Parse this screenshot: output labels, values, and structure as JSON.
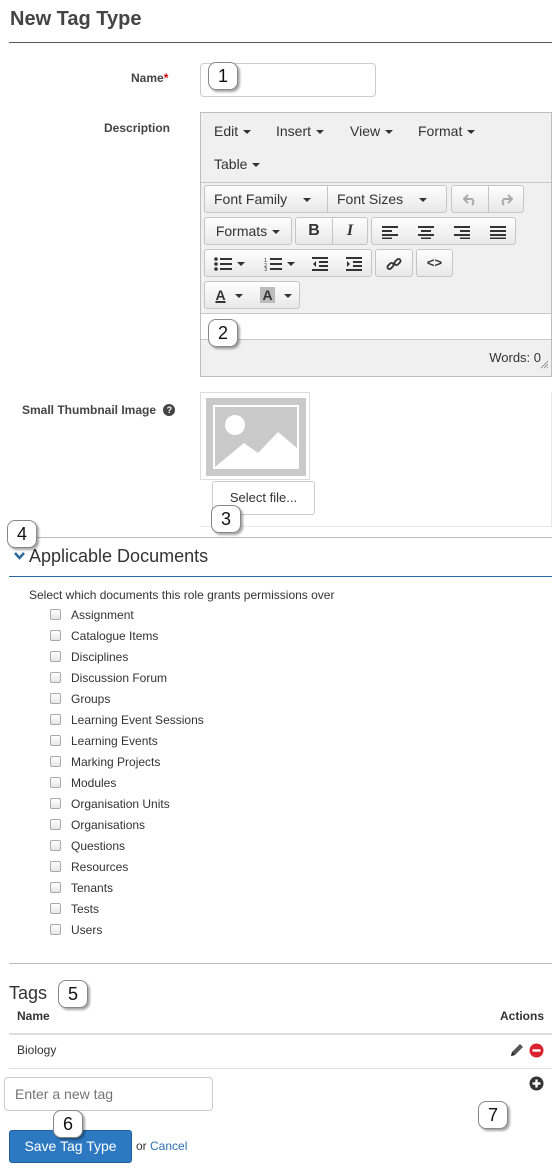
{
  "page": {
    "title": "New Tag Type"
  },
  "form": {
    "name_label": "Name",
    "required_mark": "*",
    "description_label": "Description",
    "thumbnail_label": "Small Thumbnail Image",
    "select_file_label": "Select file..."
  },
  "editor": {
    "menus": [
      "Edit",
      "Insert",
      "View",
      "Format",
      "Table"
    ],
    "font_family": "Font Family",
    "font_sizes": "Font Sizes",
    "formats": "Formats",
    "bold": "B",
    "italic": "I",
    "code": "<>",
    "text_color": "A",
    "bg_color": "A",
    "word_count": "Words: 0"
  },
  "documents": {
    "title": "Applicable Documents",
    "help": "Select which documents this role grants permissions over",
    "items": [
      "Assignment",
      "Catalogue Items",
      "Disciplines",
      "Discussion Forum",
      "Groups",
      "Learning Event Sessions",
      "Learning Events",
      "Marking Projects",
      "Modules",
      "Organisation Units",
      "Organisations",
      "Questions",
      "Resources",
      "Tenants",
      "Tests",
      "Users"
    ]
  },
  "tags": {
    "title": "Tags",
    "col_name": "Name",
    "col_actions": "Actions",
    "rows": [
      "Biology"
    ],
    "new_placeholder": "Enter a new tag"
  },
  "footer": {
    "save_label": "Save Tag Type",
    "or_text": "or",
    "cancel_label": "Cancel"
  },
  "callouts": [
    "1",
    "2",
    "3",
    "4",
    "5",
    "6",
    "7"
  ],
  "colors": {
    "accent": "#2d79c1",
    "remove": "#d9232e",
    "section_rule": "#2b6a9e"
  }
}
